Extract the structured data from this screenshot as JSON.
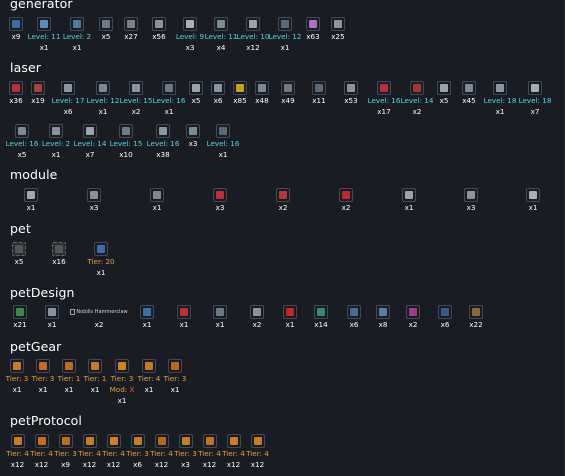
{
  "sections": {
    "generator": {
      "title": "generator",
      "items": [
        {
          "cap": "",
          "value": "x9",
          "kind": "cnt",
          "sub": "",
          "color": "#3a6ea8"
        },
        {
          "cap": "",
          "value": "Level: 11",
          "kind": "lvl",
          "sub": "x1",
          "color": "#5a8fb8"
        },
        {
          "cap": "",
          "value": "Level: 2",
          "kind": "lvl",
          "sub": "x1",
          "color": "#4a7aa0"
        },
        {
          "cap": "",
          "value": "x5",
          "kind": "cnt",
          "sub": "",
          "color": "#6e7a86"
        },
        {
          "cap": "",
          "value": "x27",
          "kind": "cnt",
          "sub": "",
          "color": "#7a838c"
        },
        {
          "cap": "",
          "value": "x56",
          "kind": "cnt",
          "sub": "",
          "color": "#8a94a0"
        },
        {
          "cap": "",
          "value": "Level: 9",
          "kind": "lvl",
          "sub": "x3",
          "color": "#a6b0ba"
        },
        {
          "cap": "",
          "value": "Level: 11",
          "kind": "lvl",
          "sub": "x4",
          "color": "#7c8894"
        },
        {
          "cap": "",
          "value": "Level: 10",
          "kind": "lvl",
          "sub": "x12",
          "color": "#9aa4ae"
        },
        {
          "cap": "",
          "value": "Level: 12",
          "kind": "lvl",
          "sub": "x1",
          "color": "#5c6a78"
        },
        {
          "cap": "",
          "value": "x63",
          "kind": "cnt",
          "sub": "",
          "color": "#b06cc0"
        },
        {
          "cap": "",
          "value": "x25",
          "kind": "cnt",
          "sub": "",
          "color": "#8c96a2"
        }
      ]
    },
    "laser": {
      "title": "laser",
      "rows": [
        [
          {
            "cap": "",
            "value": "x36",
            "kind": "cnt",
            "sub": "",
            "color": "#b0303a"
          },
          {
            "cap": "",
            "value": "x19",
            "kind": "cnt",
            "sub": "",
            "color": "#a84040"
          },
          {
            "cap": "",
            "value": "Level: 17",
            "kind": "lvl",
            "sub": "x6",
            "color": "#8c96a2"
          },
          {
            "cap": "",
            "value": "Level: 12",
            "kind": "lvl",
            "sub": "x1",
            "color": "#7c8894"
          },
          {
            "cap": "",
            "value": "Level: 15",
            "kind": "lvl",
            "sub": "x2",
            "color": "#8a94a0"
          },
          {
            "cap": "",
            "value": "Level: 16",
            "kind": "lvl",
            "sub": "x1",
            "color": "#6e7a86"
          },
          {
            "cap": "",
            "value": "x5",
            "kind": "cnt",
            "sub": "",
            "color": "#9aa4ae"
          },
          {
            "cap": "",
            "value": "x6",
            "kind": "cnt",
            "sub": "",
            "color": "#8a94a0"
          },
          {
            "cap": "",
            "value": "x85",
            "kind": "cnt",
            "sub": "",
            "color": "#c8a020"
          },
          {
            "cap": "",
            "value": "x48",
            "kind": "cnt",
            "sub": "",
            "color": "#7c8894"
          },
          {
            "cap": "",
            "value": "x49",
            "kind": "cnt",
            "sub": "",
            "color": "#6e7a86"
          },
          {
            "cap": "",
            "value": "x11",
            "kind": "cnt",
            "sub": "",
            "color": "#5c6a78"
          },
          {
            "cap": "",
            "value": "x53",
            "kind": "cnt",
            "sub": "",
            "color": "#8a94a0"
          },
          {
            "cap": "",
            "value": "Level: 16",
            "kind": "lvl",
            "sub": "x17",
            "color": "#b0303a"
          },
          {
            "cap": "",
            "value": "Level: 14",
            "kind": "lvl",
            "sub": "x2",
            "color": "#a03838"
          },
          {
            "cap": "",
            "value": "x5",
            "kind": "cnt",
            "sub": "",
            "color": "#9aa4ae"
          },
          {
            "cap": "",
            "value": "x45",
            "kind": "cnt",
            "sub": "",
            "color": "#7c8894"
          },
          {
            "cap": "",
            "value": "Level: 18",
            "kind": "lvl",
            "sub": "x1",
            "color": "#8c96a2"
          },
          {
            "cap": "",
            "value": "Level: 18",
            "kind": "lvl",
            "sub": "x7",
            "color": "#a6b0ba"
          }
        ],
        [
          {
            "cap": "",
            "value": "Level: 16",
            "kind": "lvl",
            "sub": "x5",
            "color": "#7c8894"
          },
          {
            "cap": "",
            "value": "Level: 2",
            "kind": "lvl",
            "sub": "x1",
            "color": "#8a94a0"
          },
          {
            "cap": "",
            "value": "Level: 14",
            "kind": "lvl",
            "sub": "x7",
            "color": "#9aa4ae"
          },
          {
            "cap": "",
            "value": "Level: 15",
            "kind": "lvl",
            "sub": "x10",
            "color": "#6e7a86"
          },
          {
            "cap": "",
            "value": "Level: 16",
            "kind": "lvl",
            "sub": "x38",
            "color": "#8c96a2"
          },
          {
            "cap": "",
            "value": "x3",
            "kind": "cnt",
            "sub": "",
            "color": "#7c8894"
          },
          {
            "cap": "",
            "value": "Level: 16",
            "kind": "lvl",
            "sub": "x1",
            "color": "#5c6a78"
          }
        ]
      ]
    },
    "module": {
      "title": "module",
      "items": [
        {
          "cap": "",
          "value": "x1",
          "kind": "cnt",
          "sub": "",
          "color": "#a0a8b2"
        },
        {
          "cap": "",
          "value": "x3",
          "kind": "cnt",
          "sub": "",
          "color": "#8a94a0"
        },
        {
          "cap": "",
          "value": "x1",
          "kind": "cnt",
          "sub": "",
          "color": "#7c8894"
        },
        {
          "cap": "",
          "value": "x3",
          "kind": "cnt",
          "sub": "",
          "color": "#c03030"
        },
        {
          "cap": "",
          "value": "x2",
          "kind": "cnt",
          "sub": "",
          "color": "#b83838"
        },
        {
          "cap": "",
          "value": "x2",
          "kind": "cnt",
          "sub": "",
          "color": "#c02828"
        },
        {
          "cap": "",
          "value": "x1",
          "kind": "cnt",
          "sub": "",
          "color": "#9aa4ae"
        },
        {
          "cap": "",
          "value": "x3",
          "kind": "cnt",
          "sub": "",
          "color": "#8c96a2"
        },
        {
          "cap": "",
          "value": "x1",
          "kind": "cnt",
          "sub": "",
          "color": "#a6b0ba"
        }
      ]
    },
    "pet": {
      "title": "pet",
      "items": [
        {
          "cap": "",
          "value": "x5",
          "kind": "cnt",
          "sub": "",
          "color": "#555",
          "dim": true
        },
        {
          "cap": "",
          "value": "x16",
          "kind": "cnt",
          "sub": "",
          "color": "#555",
          "dim": true
        },
        {
          "cap": "",
          "value": "Tier: 20",
          "kind": "tier",
          "sub": "x1",
          "color": "#3a6ea8"
        }
      ]
    },
    "petDesign": {
      "title": "petDesign",
      "broken_alt": "Nobilis Hammerclaw",
      "items": [
        {
          "cap": "",
          "value": "x21",
          "kind": "cnt",
          "sub": "",
          "color": "#3a8a4a"
        },
        {
          "cap": "",
          "value": "x1",
          "kind": "cnt",
          "sub": "",
          "color": "#8a94a0"
        },
        {
          "cap": "",
          "value": "x2",
          "kind": "cnt",
          "sub": "",
          "color": "",
          "broken": true
        },
        {
          "cap": "",
          "value": "x1",
          "kind": "cnt",
          "sub": "",
          "color": "#3a6ea8"
        },
        {
          "cap": "",
          "value": "x1",
          "kind": "cnt",
          "sub": "",
          "color": "#c03030"
        },
        {
          "cap": "",
          "value": "x1",
          "kind": "cnt",
          "sub": "",
          "color": "#6e7a86"
        },
        {
          "cap": "",
          "value": "x2",
          "kind": "cnt",
          "sub": "",
          "color": "#8a94a0"
        },
        {
          "cap": "",
          "value": "x1",
          "kind": "cnt",
          "sub": "",
          "color": "#c02828"
        },
        {
          "cap": "",
          "value": "x14",
          "kind": "cnt",
          "sub": "",
          "color": "#3a8a6a"
        },
        {
          "cap": "",
          "value": "x6",
          "kind": "cnt",
          "sub": "",
          "color": "#4a6a9a"
        },
        {
          "cap": "",
          "value": "x8",
          "kind": "cnt",
          "sub": "",
          "color": "#5a7aaa"
        },
        {
          "cap": "",
          "value": "x2",
          "kind": "cnt",
          "sub": "",
          "color": "#a03a8a"
        },
        {
          "cap": "",
          "value": "x6",
          "kind": "cnt",
          "sub": "",
          "color": "#3a5a8a"
        },
        {
          "cap": "",
          "value": "x22",
          "kind": "cnt",
          "sub": "",
          "color": "#8a6a3a"
        }
      ]
    },
    "petGear": {
      "title": "petGear",
      "items": [
        {
          "cap": "",
          "value": "Tier: 3",
          "kind": "tier",
          "sub": "x1",
          "color": "#c87a20"
        },
        {
          "cap": "",
          "value": "Tier: 3",
          "kind": "tier",
          "sub": "x1",
          "color": "#c86a20"
        },
        {
          "cap": "",
          "value": "Tier: 1",
          "kind": "tier",
          "sub": "x1",
          "color": "#b87020"
        },
        {
          "cap": "",
          "value": "Tier: 1",
          "kind": "tier",
          "sub": "x1",
          "color": "#c07a28"
        },
        {
          "cap": "",
          "value": "Tier: 3",
          "kind": "tier",
          "mod": "Mod: ",
          "modx": "X",
          "sub": "x1",
          "color": "#d08020"
        },
        {
          "cap": "",
          "value": "Tier: 4",
          "kind": "tier",
          "sub": "x1",
          "color": "#c87a20"
        },
        {
          "cap": "",
          "value": "Tier: 3",
          "kind": "tier",
          "sub": "x1",
          "color": "#b86a18"
        }
      ]
    },
    "petProtocol": {
      "title": "petProtocol",
      "items": [
        {
          "cap": "",
          "value": "Tier: 4",
          "kind": "tier",
          "sub": "x12",
          "color": "#c87a20"
        },
        {
          "cap": "",
          "value": "Tier: 4",
          "kind": "tier",
          "sub": "x12",
          "color": "#c86a20"
        },
        {
          "cap": "",
          "value": "Tier: 3",
          "kind": "tier",
          "sub": "x9",
          "color": "#b87020"
        },
        {
          "cap": "",
          "value": "Tier: 4",
          "kind": "tier",
          "sub": "x12",
          "color": "#c07a28"
        },
        {
          "cap": "",
          "value": "Tier: 4",
          "kind": "tier",
          "sub": "x12",
          "color": "#d08020"
        },
        {
          "cap": "",
          "value": "Tier: 3",
          "kind": "tier",
          "sub": "x6",
          "color": "#c87a20"
        },
        {
          "cap": "",
          "value": "Tier: 4",
          "kind": "tier",
          "sub": "x12",
          "color": "#b86a18"
        },
        {
          "cap": "",
          "value": "Tier: 3",
          "kind": "tier",
          "sub": "x3",
          "color": "#c87a20"
        },
        {
          "cap": "",
          "value": "Tier: 4",
          "kind": "tier",
          "sub": "x12",
          "color": "#c07020"
        },
        {
          "cap": "",
          "value": "Tier: 4",
          "kind": "tier",
          "sub": "x12",
          "color": "#d07a20"
        },
        {
          "cap": "",
          "value": "Tier: 4",
          "kind": "tier",
          "sub": "x12",
          "color": "#c87a20"
        }
      ]
    }
  }
}
